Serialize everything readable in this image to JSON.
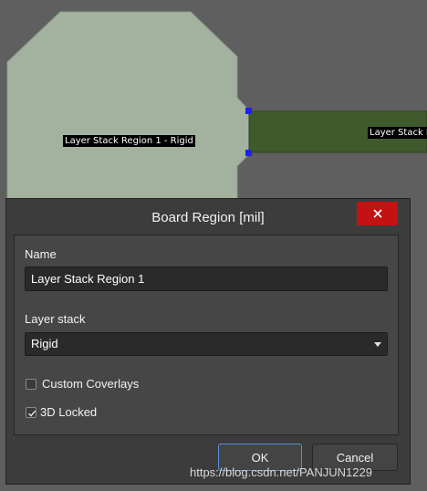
{
  "board": {
    "region1_label": "Layer Stack Region 1 - Rigid",
    "region2_label": "Layer Stack R",
    "colors": {
      "background": "#5f5f5f",
      "rigid_region": "#a2b29e",
      "flex_region": "#3f5a2c",
      "handle": "#1e1eff"
    }
  },
  "dialog": {
    "title": "Board Region [mil]",
    "close_icon": "close-icon",
    "name_label": "Name",
    "name_value": "Layer Stack Region 1",
    "layer_stack_label": "Layer stack",
    "layer_stack_value": "Rigid",
    "custom_coverlays_label": "Custom Coverlays",
    "custom_coverlays_checked": false,
    "locked_3d_label": "3D Locked",
    "locked_3d_checked": true,
    "ok_label": "OK",
    "cancel_label": "Cancel",
    "colors": {
      "close_button": "#c41111",
      "ok_focus_border": "#5b8fd6"
    }
  },
  "watermark": "https://blog.csdn.net/PANJUN1229"
}
